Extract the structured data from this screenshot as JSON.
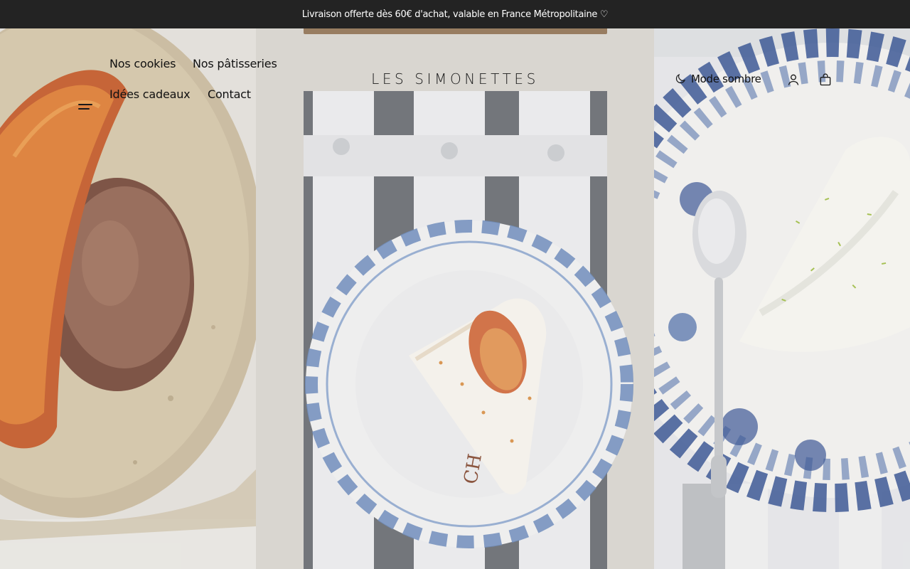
{
  "announcement": {
    "text": "Livraison offerte dès 60€ d'achat, valable en France Métropolitaine ♡"
  },
  "header": {
    "menu_icon": "hamburger-menu-icon",
    "nav": [
      {
        "label": "Nos cookies"
      },
      {
        "label": "Nos pâtisseries"
      },
      {
        "label": "Idées cadeaux"
      },
      {
        "label": "Contact"
      }
    ],
    "logo": "LES SIMONETTES",
    "mode_toggle": {
      "icon": "moon-icon",
      "label": "Mode sombre"
    },
    "account_icon": "user-icon",
    "cart_icon": "shopping-bag-icon"
  },
  "hero": {
    "images": [
      {
        "name": "cookie-with-candied-orange"
      },
      {
        "name": "meringue-cake-slice-on-blue-plate"
      },
      {
        "name": "lime-meringue-cake-with-spoon"
      }
    ]
  },
  "colors": {
    "announcement_bg": "#232323",
    "announcement_text": "#ffffff",
    "header_text": "#111111"
  }
}
